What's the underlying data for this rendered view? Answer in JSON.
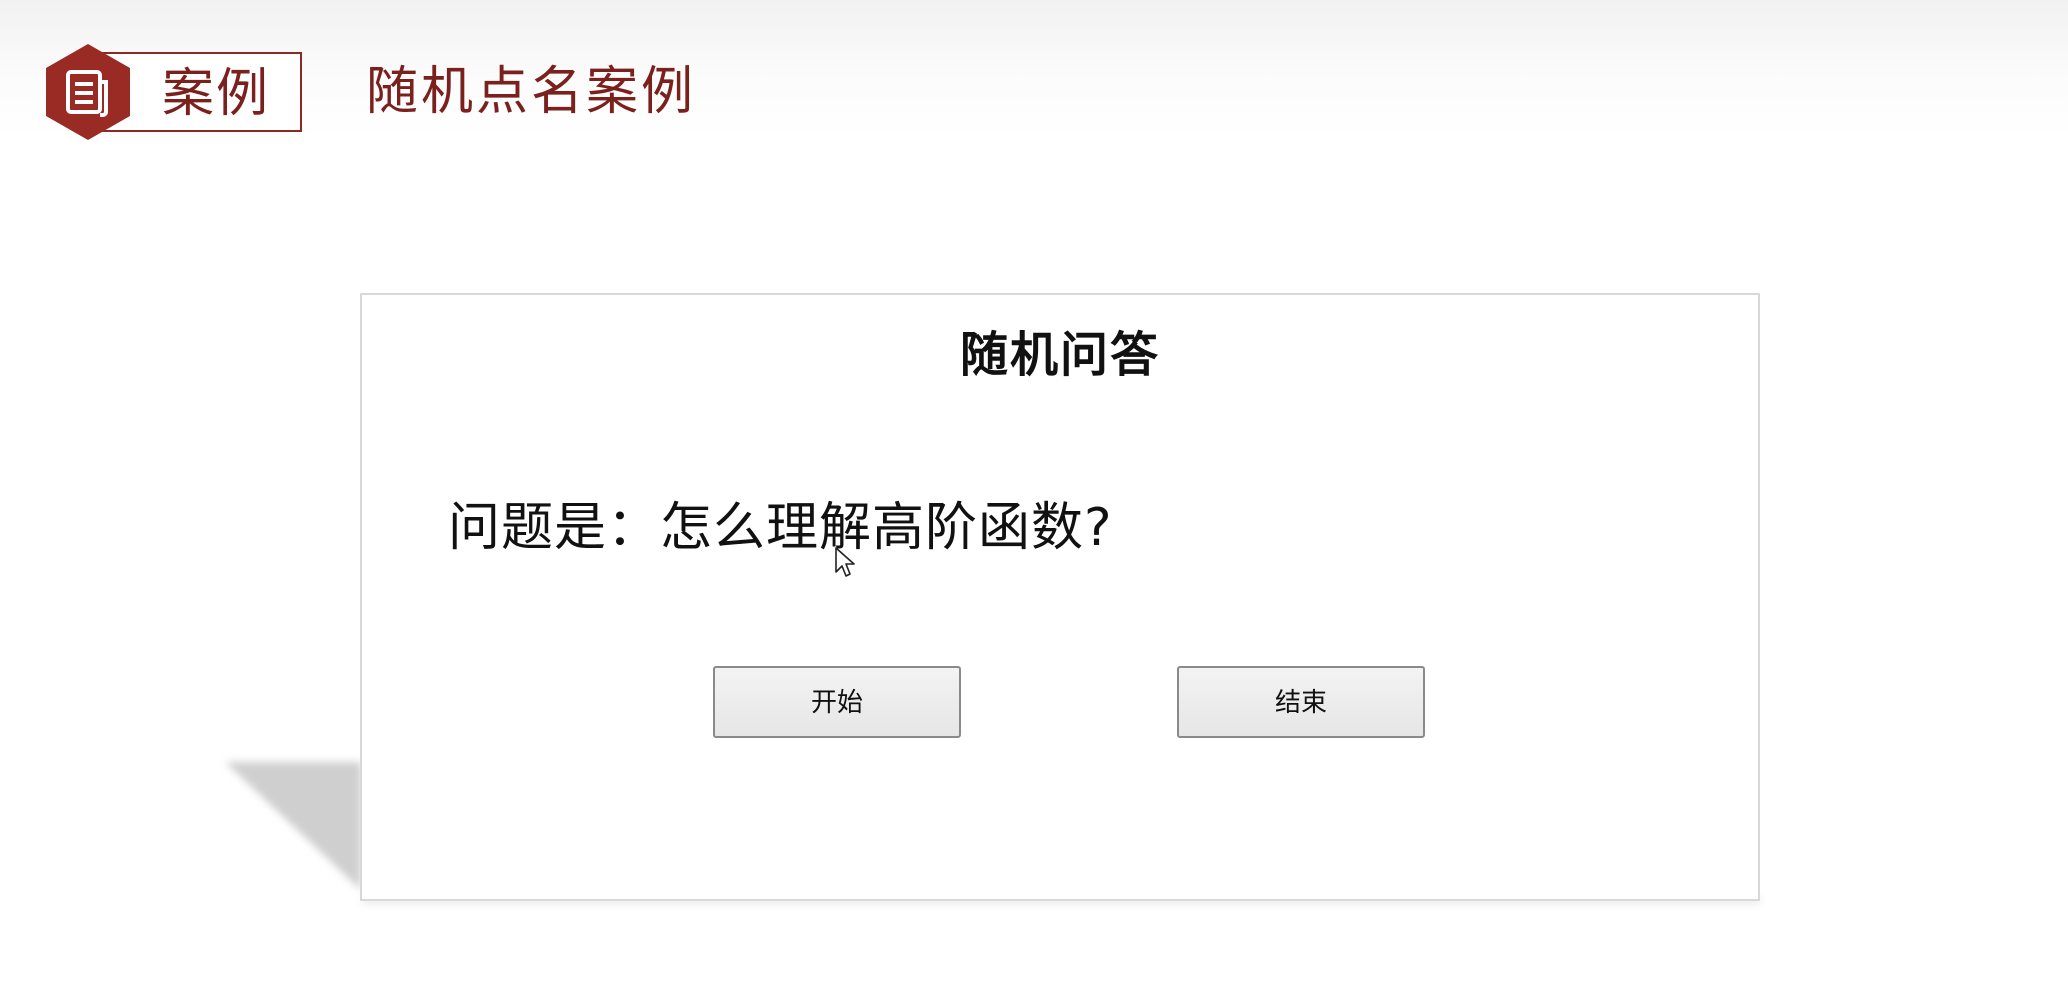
{
  "header": {
    "badge_label": "案例",
    "title": "随机点名案例",
    "brand_color": "#7a211d",
    "badge_icon": "document-icon"
  },
  "card": {
    "title": "随机问答",
    "question": "问题是：怎么理解高阶函数?",
    "buttons": {
      "start_label": "开始",
      "end_label": "结束"
    }
  }
}
